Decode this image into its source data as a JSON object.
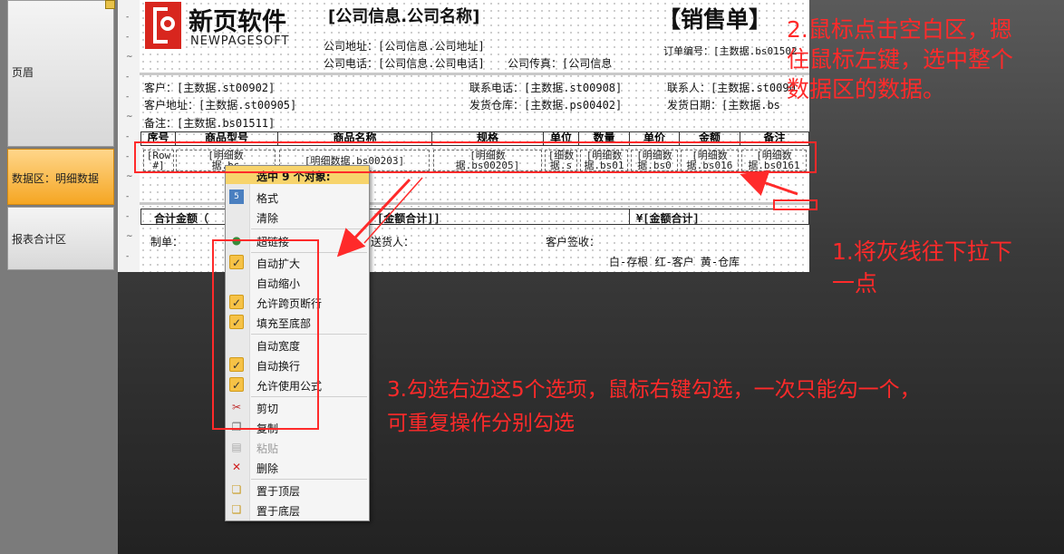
{
  "bands": {
    "header": "页眉",
    "data": "数据区：明细数据",
    "summary": "报表合计区"
  },
  "ruler_ticks": [
    "-",
    "-",
    "~",
    "-",
    "-",
    "~",
    "-",
    "-",
    "~",
    "-",
    "-",
    "~",
    "-",
    "-"
  ],
  "logo": {
    "cn": "新页软件",
    "en": "NEWPAGESOFT"
  },
  "report": {
    "company_name": "[公司信息.公司名称]",
    "title": "【销售单】",
    "address": "公司地址：[公司信息.公司地址]",
    "phone": "公司电话：[公司信息.公司电话]",
    "fax": "公司传真：[公司信息",
    "order_no": "订单编号：[主数据.bs01502",
    "customer": "客户：[主数据.st00902]",
    "customer_addr": "客户地址：[主数据.st00905]",
    "remark": "备注：[主数据.bs01511]",
    "contact_phone": "联系电话：[主数据.st00908]",
    "warehouse": "发货仓库：[主数据.ps00402]",
    "contact": "联系人：[主数据.st0090",
    "ship_date": "发货日期：[主数据.bs",
    "columns": [
      "序号",
      "商品型号",
      "商品名称",
      "规格",
      "单位",
      "数量",
      "单价",
      "金额",
      "备注"
    ],
    "row_cells": [
      "[Row\n#]",
      "[明细数\n据.bs",
      "[明细数据.bs00203]",
      "[明细数\n据.bs00205]",
      "[细数\n据.s",
      "[明细数\n据.bs01",
      "[明细数\n据.bs0",
      "[明细数\n据.bs016",
      "[明细数\n据.bs0161"
    ],
    "total_label": "合计金额（",
    "total_amount": "[金额合计]]",
    "total_currency": "¥[金额合计]",
    "maker": "制单：",
    "deliverer": "送货人：",
    "sign": "客户签收：",
    "copies": "白-存根   红-客户   黄-仓库"
  },
  "menu": {
    "header": "选中 9 个对象:",
    "items": [
      {
        "label": "格式",
        "icon": "format-icon",
        "checked": false,
        "disabled": false
      },
      {
        "label": "清除",
        "icon": "",
        "checked": false,
        "disabled": false
      },
      {
        "label": "超链接",
        "icon": "hyperlink-icon",
        "checked": false,
        "disabled": false
      },
      {
        "label": "自动扩大",
        "icon": "",
        "checked": true,
        "disabled": false
      },
      {
        "label": "自动缩小",
        "icon": "",
        "checked": false,
        "disabled": false
      },
      {
        "label": "允许跨页断行",
        "icon": "",
        "checked": true,
        "disabled": false
      },
      {
        "label": "填充至底部",
        "icon": "",
        "checked": true,
        "disabled": false
      },
      {
        "label": "自动宽度",
        "icon": "",
        "checked": false,
        "disabled": false
      },
      {
        "label": "自动换行",
        "icon": "",
        "checked": true,
        "disabled": false
      },
      {
        "label": "允许使用公式",
        "icon": "",
        "checked": true,
        "disabled": false
      },
      {
        "label": "剪切",
        "icon": "cut-icon",
        "checked": false,
        "disabled": false
      },
      {
        "label": "复制",
        "icon": "copy-icon",
        "checked": false,
        "disabled": false
      },
      {
        "label": "粘贴",
        "icon": "paste-icon",
        "checked": false,
        "disabled": true
      },
      {
        "label": "删除",
        "icon": "delete-icon",
        "checked": false,
        "disabled": false
      },
      {
        "label": "置于顶层",
        "icon": "bring-front-icon",
        "checked": false,
        "disabled": false
      },
      {
        "label": "置于底层",
        "icon": "send-back-icon",
        "checked": false,
        "disabled": false
      }
    ]
  },
  "annotations": {
    "step1": "1.将灰线往下拉下\n一点",
    "step2": "2.鼠标点击空白区，摁\n住鼠标左键，选中整个\n数据区的数据。",
    "step3": "3.勾选右边这5个选项，鼠标右键勾选，一次只能勾一个，\n可重复操作分别勾选"
  },
  "colors": {
    "annotation": "#ff2a2a",
    "selected_band": "#f5a623",
    "check": "#f6c246"
  }
}
